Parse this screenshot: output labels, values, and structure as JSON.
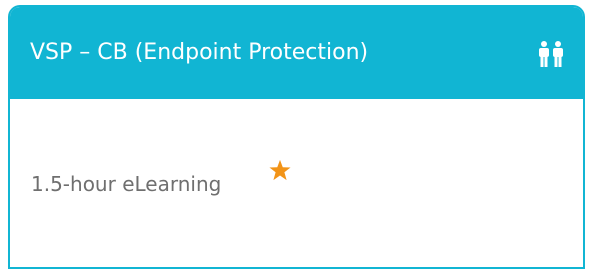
{
  "course": {
    "title": "VSP – CB (Endpoint Protection)",
    "duration": "1.5-hour eLearning",
    "audience_icon": "people-icon",
    "featured_icon": "star-icon"
  },
  "colors": {
    "header_background": "#11b5d3",
    "header_text": "#ffffff",
    "body_text": "#6f6f6f",
    "star": "#f29418"
  }
}
